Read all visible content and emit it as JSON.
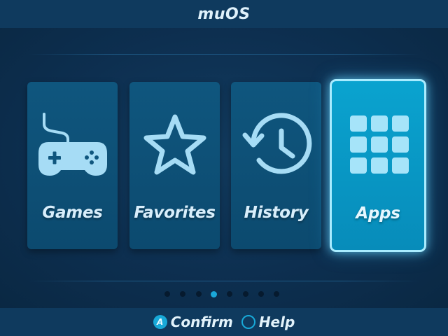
{
  "header": {
    "title": "muOS"
  },
  "menu": {
    "items": [
      {
        "label": "Games",
        "icon": "gamepad-icon"
      },
      {
        "label": "Favorites",
        "icon": "star-icon"
      },
      {
        "label": "History",
        "icon": "history-icon"
      },
      {
        "label": "Apps",
        "icon": "apps-grid-icon"
      }
    ],
    "selected_index": 3
  },
  "pagination": {
    "total": 8,
    "active_index": 3
  },
  "footer": {
    "confirm_button": "A",
    "confirm_label": "Confirm",
    "help_label": "Help"
  },
  "colors": {
    "background": "#0c2b4a",
    "bar": "#0f3a5e",
    "card": "#0f567e",
    "card_selected": "#0aa3cf",
    "accent": "#18a9d8",
    "icon": "#a6dcf5",
    "text": "#d8eefb"
  }
}
